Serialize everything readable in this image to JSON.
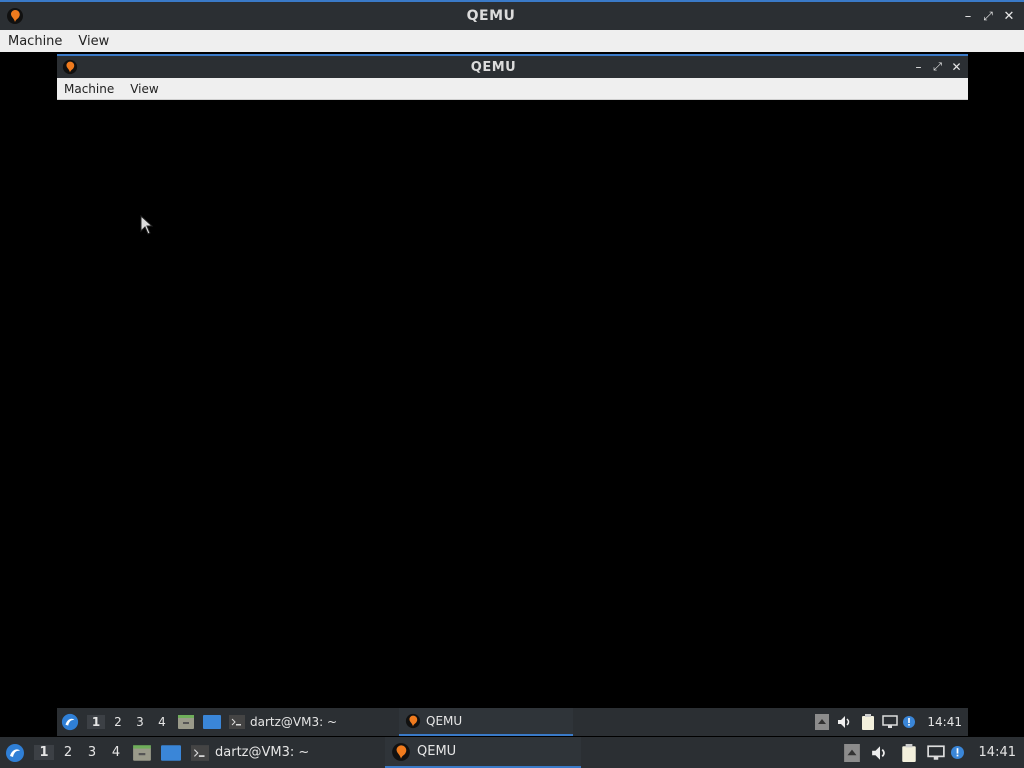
{
  "outer_window": {
    "title": "QEMU",
    "menu": [
      "Machine",
      "View"
    ],
    "controls": {
      "minimize": "–",
      "maximize": "⤢",
      "close": "✕"
    }
  },
  "inner_window": {
    "title": "QEMU",
    "menu": [
      "Machine",
      "View"
    ],
    "controls": {
      "minimize": "–",
      "maximize": "⤢",
      "close": "✕"
    }
  },
  "taskbar": {
    "workspaces": [
      "1",
      "2",
      "3",
      "4"
    ],
    "active_workspace": "1",
    "tasks": [
      {
        "label": "dartz@VM3: ~",
        "icon": "terminal-icon"
      },
      {
        "label": "QEMU",
        "icon": "qemu-icon",
        "active": true
      }
    ],
    "clock": "14:41"
  },
  "inner_taskbar": {
    "workspaces": [
      "1",
      "2",
      "3",
      "4"
    ],
    "active_workspace": "1",
    "tasks": [
      {
        "label": "dartz@VM3: ~",
        "icon": "terminal-icon"
      },
      {
        "label": "QEMU",
        "icon": "qemu-icon",
        "active": true
      }
    ],
    "clock": "14:41"
  },
  "colors": {
    "accent": "#3a7ac8",
    "panel": "#2b2f33",
    "menubar": "#efefef",
    "screen": "#000000"
  }
}
